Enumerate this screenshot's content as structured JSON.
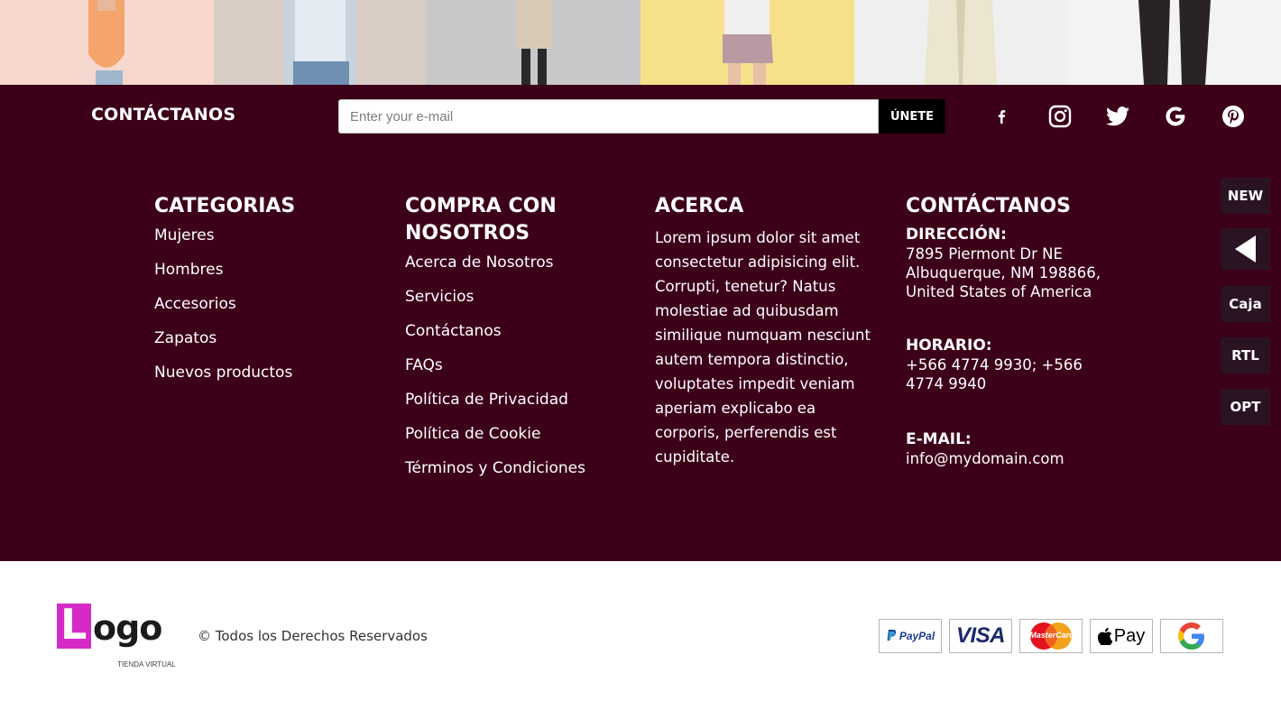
{
  "photos": [
    {
      "name": "photo-orange-top",
      "bg": "#f6d8cf"
    },
    {
      "name": "photo-white-tee",
      "bg": "#d9cdc5"
    },
    {
      "name": "photo-beige-jacket",
      "bg": "#c8c8ca"
    },
    {
      "name": "photo-denim-shorts",
      "bg": "#f6e18a"
    },
    {
      "name": "photo-cream-coat",
      "bg": "#efefef"
    },
    {
      "name": "photo-dark-trousers",
      "bg": "#f3f3f3"
    }
  ],
  "newsletter": {
    "title": "CONTÁCTANOS",
    "placeholder": "Enter your e-mail",
    "button_label": "ÚNETE"
  },
  "social_icons": [
    "facebook-icon",
    "instagram-icon",
    "twitter-icon",
    "google-icon",
    "pinterest-icon"
  ],
  "columns": {
    "categories": {
      "title": "CATEGORIAS",
      "links": [
        "Mujeres",
        "Hombres",
        "Accesorios",
        "Zapatos",
        "Nuevos productos"
      ]
    },
    "shop": {
      "title": "COMPRA CON NOSOTROS",
      "links": [
        "Acerca de Nosotros",
        "Servicios",
        "Contáctanos",
        "FAQs",
        "Política de Privacidad",
        "Política de Cookie",
        "Términos y Condiciones"
      ]
    },
    "about": {
      "title": "ACERCA",
      "text": "Lorem ipsum dolor sit amet consectetur adipisicing elit. Corrupti, tenetur? Natus molestiae ad quibusdam similique numquam nesciunt autem tempora distinctio, voluptates impedit veniam aperiam explicabo ea corporis, perferendis est cupiditate."
    },
    "contact": {
      "title": "CONTÁCTANOS",
      "address_label": "DIRECCIÓN:",
      "address": "7895 Piermont Dr NE Albuquerque, NM 198866, United States of America",
      "hours_label": "HORARIO:",
      "hours": "+566 4774 9930; +566 4774 9940",
      "email_label": "E-MAIL:",
      "email": "info@mydomain.com"
    }
  },
  "side_toolbar": {
    "new_label": "NEW",
    "box_label": "Caja",
    "rtl_label": "RTL",
    "opt_label": "OPT"
  },
  "bottom": {
    "logo_letter": "L",
    "logo_rest": "ogo",
    "logo_sub": "TIENDA VIRTUAL",
    "copyright": "© Todos los Derechos Reservados"
  },
  "payments": {
    "paypal": "PayPal",
    "visa": "VISA",
    "mastercard": "MasterCard",
    "applepay": "Pay",
    "google": "G"
  },
  "colors": {
    "footer_bg": "#3c0019",
    "accent_logo": "#d62ac7",
    "side_button_bg": "#2a1424"
  }
}
